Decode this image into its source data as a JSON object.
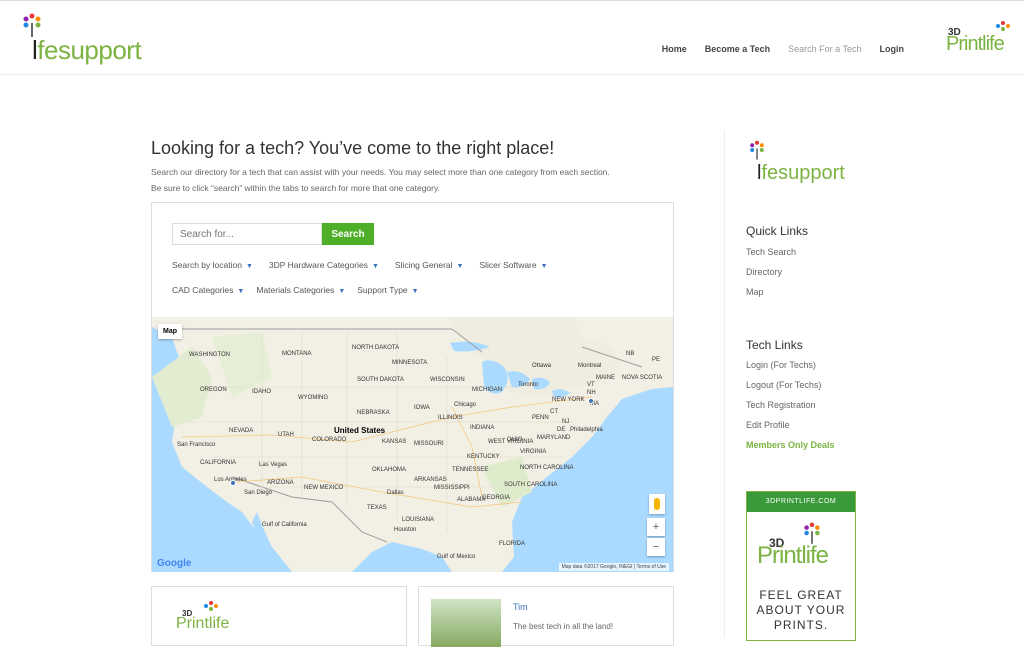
{
  "header": {
    "logo_text_prefix": "l",
    "logo_text_rest": "fesupport",
    "nav": [
      {
        "label": "Home",
        "state": "normal"
      },
      {
        "label": "Become a Tech",
        "state": "normal"
      },
      {
        "label": "Search For a Tech",
        "state": "current"
      },
      {
        "label": "Login",
        "state": "normal"
      }
    ],
    "partner_logo": {
      "top": "3D",
      "main": "Printlife"
    }
  },
  "main": {
    "title": "Looking for a tech? You’ve come to the right place!",
    "intro_line1": "Search our directory for a tech that can assist with your needs. You may select more than one category from each section.",
    "intro_line2": "Be sure to click “search” within the tabs to search for more that one category."
  },
  "search": {
    "placeholder": "Search for...",
    "button_label": "Search",
    "filters_row1": [
      "Search by location",
      "3DP Hardware Categories",
      "Slicing General",
      "Slicer Software"
    ],
    "filters_row2": [
      "CAD Categories",
      "Materials Categories",
      "Support Type"
    ]
  },
  "map": {
    "type_button": "Map",
    "zoom_in": "+",
    "zoom_out": "−",
    "attribution": "Map data ©2017 Google, INEGI | Terms of Use",
    "watermark": "Google",
    "labels": [
      {
        "text": "WASHINGTON"
      },
      {
        "text": "MONTANA"
      },
      {
        "text": "NORTH DAKOTA"
      },
      {
        "text": "MINNESOTA"
      },
      {
        "text": "OREGON"
      },
      {
        "text": "IDAHO"
      },
      {
        "text": "SOUTH DAKOTA"
      },
      {
        "text": "WISCONSIN"
      },
      {
        "text": "MICHIGAN"
      },
      {
        "text": "Ottawa"
      },
      {
        "text": "Montreal"
      },
      {
        "text": "Toronto"
      },
      {
        "text": "WYOMING"
      },
      {
        "text": "NEBRASKA"
      },
      {
        "text": "IOWA"
      },
      {
        "text": "Chicago"
      },
      {
        "text": "NEW YORK"
      },
      {
        "text": "NEVADA"
      },
      {
        "text": "UTAH"
      },
      {
        "text": "COLORADO"
      },
      {
        "text": "United States"
      },
      {
        "text": "KANSAS"
      },
      {
        "text": "MISSOURI"
      },
      {
        "text": "ILLINOIS"
      },
      {
        "text": "INDIANA"
      },
      {
        "text": "OHIO"
      },
      {
        "text": "PENN"
      },
      {
        "text": "Philadelphia"
      },
      {
        "text": "San Francisco"
      },
      {
        "text": "CALIFORNIA"
      },
      {
        "text": "Las Vegas"
      },
      {
        "text": "ARIZONA"
      },
      {
        "text": "NEW MEXICO"
      },
      {
        "text": "OKLAHOMA"
      },
      {
        "text": "ARKANSAS"
      },
      {
        "text": "TENNESSEE"
      },
      {
        "text": "KENTUCKY"
      },
      {
        "text": "VIRGINIA"
      },
      {
        "text": "NORTH CAROLINA"
      },
      {
        "text": "Los Angeles"
      },
      {
        "text": "San Diego"
      },
      {
        "text": "Dallas"
      },
      {
        "text": "MISSISSIPPI"
      },
      {
        "text": "ALABAMA"
      },
      {
        "text": "GEORGIA"
      },
      {
        "text": "SOUTH CAROLINA"
      },
      {
        "text": "TEXAS"
      },
      {
        "text": "Houston"
      },
      {
        "text": "Gulf of Mexico"
      },
      {
        "text": "FLORIDA"
      },
      {
        "text": "Gulf of California"
      },
      {
        "text": "MAINE"
      },
      {
        "text": "NOVA SCOTIA"
      },
      {
        "text": "NB"
      },
      {
        "text": "PE"
      },
      {
        "text": "VT"
      },
      {
        "text": "NH"
      },
      {
        "text": "MA"
      },
      {
        "text": "CT"
      },
      {
        "text": "WEST VIRGINIA"
      },
      {
        "text": "MARYLAND"
      },
      {
        "text": "NJ"
      },
      {
        "text": "DE"
      },
      {
        "text": "LOUISIANA"
      }
    ]
  },
  "cards": [
    {
      "logo_top": "3D",
      "logo_main": "Printlife"
    },
    {
      "name": "Tim",
      "description": "The best tech in all the land!"
    }
  ],
  "sidebar": {
    "logo_prefix": "l",
    "logo_rest": "fesupport",
    "quick_links_title": "Quick Links",
    "quick_links": [
      "Tech Search",
      "Directory",
      "Map"
    ],
    "tech_links_title": "Tech Links",
    "tech_links": [
      "Login (For Techs)",
      "Logout (For Techs)",
      "Tech Registration",
      "Edit Profile",
      "Members Only Deals"
    ],
    "ad": {
      "header": "3DPRINTLIFE.COM",
      "logo_top": "3D",
      "logo_main": "Printlife",
      "tagline_line1": "FEEL GREAT",
      "tagline_line2": "ABOUT YOUR",
      "tagline_line3": "PRINTS."
    }
  },
  "colors": {
    "brand_green": "#7cb342",
    "button_green": "#4caf27",
    "link_blue": "#3b73b9"
  }
}
